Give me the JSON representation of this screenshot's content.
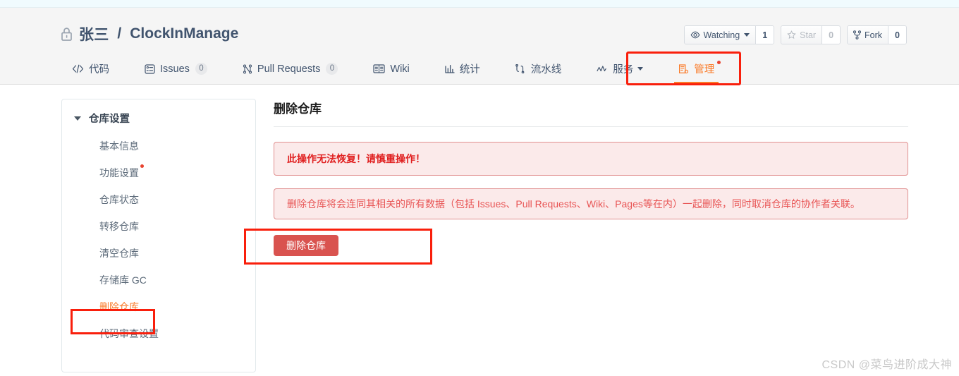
{
  "repo": {
    "visibility_icon": "lock-icon",
    "owner": "张三",
    "separator": "/",
    "name": "ClockInManage"
  },
  "header_actions": {
    "watch": {
      "icon": "eye-icon",
      "label": "Watching",
      "count": "1",
      "has_dropdown": true
    },
    "star": {
      "icon": "star-icon",
      "label": "Star",
      "count": "0",
      "disabled": true
    },
    "fork": {
      "icon": "fork-icon",
      "label": "Fork",
      "count": "0"
    }
  },
  "nav_tabs": [
    {
      "icon": "code-icon",
      "label": "代码",
      "badge": null,
      "active": false,
      "dot": false
    },
    {
      "icon": "issues-icon",
      "label": "Issues",
      "badge": "0",
      "active": false,
      "dot": false
    },
    {
      "icon": "pull-request-icon",
      "label": "Pull Requests",
      "badge": "0",
      "active": false,
      "dot": false
    },
    {
      "icon": "wiki-icon",
      "label": "Wiki",
      "badge": null,
      "active": false,
      "dot": false
    },
    {
      "icon": "stats-icon",
      "label": "统计",
      "badge": null,
      "active": false,
      "dot": false
    },
    {
      "icon": "pipeline-icon",
      "label": "流水线",
      "badge": null,
      "active": false,
      "dot": false
    },
    {
      "icon": "service-icon",
      "label": "服务",
      "badge": null,
      "active": false,
      "dot": false,
      "has_dropdown": true
    },
    {
      "icon": "manage-icon",
      "label": "管理",
      "badge": null,
      "active": true,
      "dot": true
    }
  ],
  "sidebar": {
    "title": "仓库设置",
    "items": [
      {
        "label": "基本信息",
        "active": false,
        "dot": false
      },
      {
        "label": "功能设置",
        "active": false,
        "dot": true
      },
      {
        "label": "仓库状态",
        "active": false,
        "dot": false
      },
      {
        "label": "转移仓库",
        "active": false,
        "dot": false
      },
      {
        "label": "清空仓库",
        "active": false,
        "dot": false
      },
      {
        "label": "存储库 GC",
        "active": false,
        "dot": false
      },
      {
        "label": "删除仓库",
        "active": true,
        "dot": false
      },
      {
        "label": "代码审查设置",
        "active": false,
        "dot": false
      }
    ]
  },
  "main": {
    "title": "删除仓库",
    "alert_danger": "此操作无法恢复！请慎重操作！",
    "alert_info": "删除仓库将会连同其相关的所有数据（包括 Issues、Pull Requests、Wiki、Pages等在内）一起删除，同时取消仓库的协作者关联。",
    "delete_button": "删除仓库"
  },
  "watermark": "CSDN @菜鸟进阶成大神",
  "colors": {
    "accent_orange": "#fa7a28",
    "danger_red": "#e02020",
    "annotation_red": "#f91f0c",
    "delete_button_bg": "#d9534f",
    "header_bg": "#f5f5f5",
    "top_strip": "#f0fbfe",
    "text_primary": "#41546e"
  }
}
